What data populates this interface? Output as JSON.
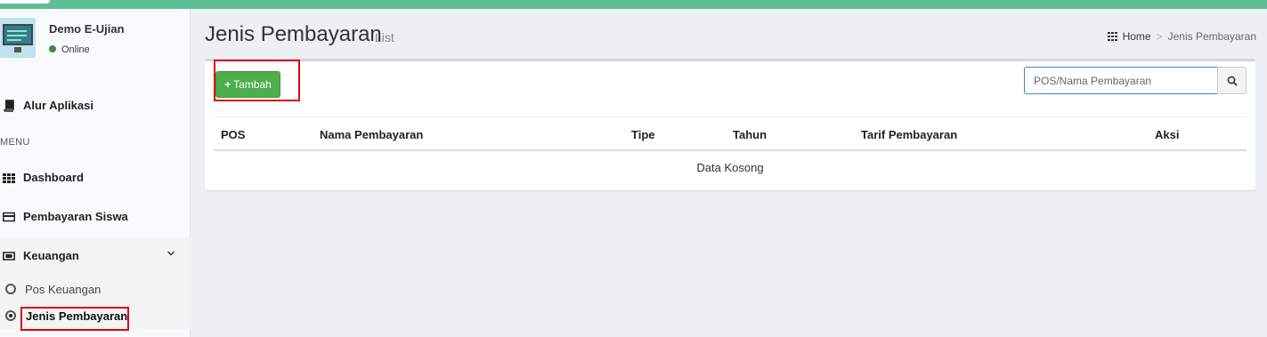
{
  "sidebar": {
    "user": {
      "name": "Demo E-Ujian",
      "status": "Online"
    },
    "alur": "Alur Aplikasi",
    "menu_header": "MENU",
    "items": [
      {
        "label": "Dashboard",
        "icon": "grid-icon"
      },
      {
        "label": "Pembayaran Siswa",
        "icon": "credit-card-icon"
      },
      {
        "label": "Keuangan",
        "icon": "money-icon"
      }
    ],
    "sub_items": [
      {
        "label": "Pos Keuangan"
      },
      {
        "label": "Jenis Pembayaran"
      }
    ]
  },
  "header": {
    "title": "Jenis Pembayaran",
    "subtitle": "List"
  },
  "breadcrumb": {
    "home": "Home",
    "current": "Jenis Pembayaran"
  },
  "toolbar": {
    "add_label": "Tambah",
    "search_placeholder": "POS/Nama Pembayaran"
  },
  "table": {
    "columns": [
      "POS",
      "Nama Pembayaran",
      "Tipe",
      "Tahun",
      "Tarif Pembayaran",
      "Aksi"
    ],
    "empty_text": "Data Kosong"
  },
  "colors": {
    "topbar": "#5ebd93",
    "add_button": "#4cae4c",
    "highlight": "#e00000"
  }
}
